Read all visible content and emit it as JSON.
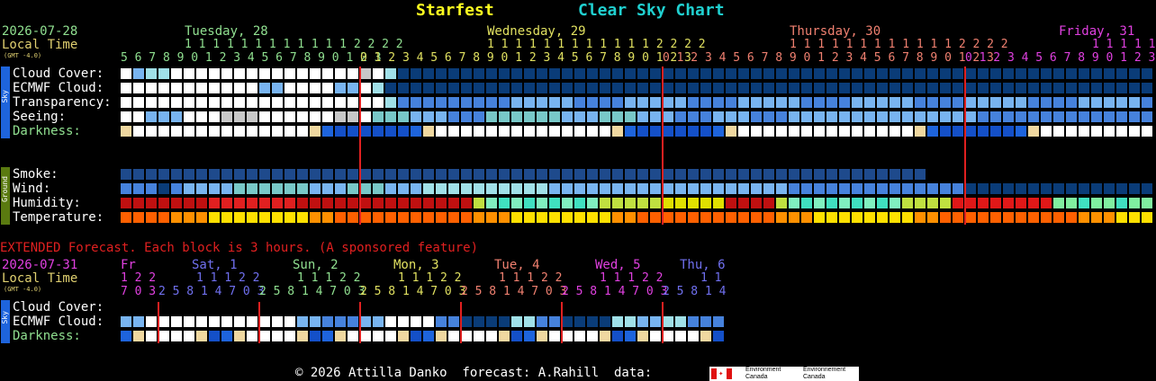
{
  "header": {
    "site_name": "Starfest",
    "chart_name": "Clear Sky Chart",
    "colors": {
      "site": "#ffff20",
      "chart": "#20d0d0"
    }
  },
  "main": {
    "date": "2026-07-28",
    "local_time": "Local Time",
    "gmt": "(GMT -4.0)",
    "days": [
      {
        "label": "Tuesday, 28",
        "color": "#90e090"
      },
      {
        "label": "Wednesday, 29",
        "color": "#e0e060"
      },
      {
        "label": "Thursday, 30",
        "color": "#f08070"
      },
      {
        "label": "Friday, 31",
        "color": "#e040e0"
      }
    ],
    "hour_tens": "1 1 1 1 1 1 1 1 1 1 1 1 2 2 2 2",
    "hour_tens_short": "1 1 1 1 1",
    "hours_start": "5 6 7 8 9 0 1 2 3 4 5 6 7 8 9 0 1 2 3",
    "hours_day": "0 1 2 3 4 5 6 7 8 9 0 1 2 3 4 5 6 7 8 9 0 1 2 3",
    "hours_end": "0 1 2 3 4 5 6 7 8 9 0 1 2 3 4",
    "sky_rows": [
      "Cloud Cover:",
      "ECMWF Cloud:",
      "Transparency:",
      "Seeing:",
      "Darkness:"
    ],
    "ground_rows": [
      "Smoke:",
      "Wind:",
      "Humidity:",
      "Temperature:"
    ],
    "sky_tag": "Sky",
    "ground_tag": "Ground"
  },
  "extended": {
    "notice": "EXTENDED Forecast. Each block is 3 hours. (A sponsored feature)",
    "date": "2026-07-31",
    "local_time": "Local Time",
    "gmt": "(GMT -4.0)",
    "days": [
      {
        "label": "Fr",
        "color": "#e040e0",
        "tens": "1 2 2",
        "hours": "7 0 3"
      },
      {
        "label": "Sat, 1",
        "color": "#7070f0",
        "tens": "1 1 1 2 2",
        "hours": "2 5 8 1 4 7 0 3"
      },
      {
        "label": "Sun, 2",
        "color": "#90e090",
        "tens": "1 1 1 2 2",
        "hours": "2 5 8 1 4 7 0 3"
      },
      {
        "label": "Mon, 3",
        "color": "#e0e060",
        "tens": "1 1 1 2 2",
        "hours": "2 5 8 1 4 7 0 3"
      },
      {
        "label": "Tue, 4",
        "color": "#f08070",
        "tens": "1 1 1 2 2",
        "hours": "2 5 8 1 4 7 0 3"
      },
      {
        "label": "Wed, 5",
        "color": "#e040e0",
        "tens": "1 1 1 2 2",
        "hours": "2 5 8 1 4 7 0 3"
      },
      {
        "label": "Thu, 6",
        "color": "#7070f0",
        "tens": "1 1",
        "hours": "2 5 8 1 4"
      }
    ],
    "rows": [
      "Cloud Cover:",
      "ECMWF Cloud:",
      "Darkness:"
    ],
    "sky_tag": "Sky"
  },
  "footer": {
    "copyright": "© 2026 Attilla Danko  forecast: A.Rahill  data:",
    "logo_text_en": "Environment Canada",
    "logo_text_fr": "Environnement Canada"
  }
}
